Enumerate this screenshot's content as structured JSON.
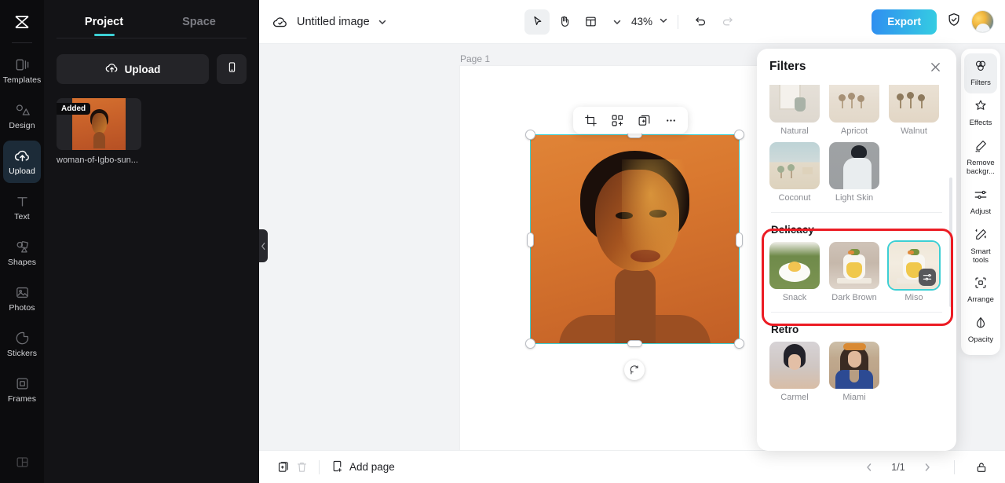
{
  "app": {
    "brand_icon": "capcut-logo-icon",
    "accent_teal": "#3ccfd4",
    "accent_red": "#ec1c24",
    "export_gradient_from": "#2f8ef0",
    "export_gradient_to": "#35cde2"
  },
  "rail": {
    "items": [
      {
        "label": "Templates",
        "icon": "templates-icon",
        "active": false
      },
      {
        "label": "Design",
        "icon": "design-icon",
        "active": false
      },
      {
        "label": "Upload",
        "icon": "upload-cloud-icon",
        "active": true
      },
      {
        "label": "Text",
        "icon": "text-icon",
        "active": false
      },
      {
        "label": "Shapes",
        "icon": "shapes-icon",
        "active": false
      },
      {
        "label": "Photos",
        "icon": "photos-icon",
        "active": false
      },
      {
        "label": "Stickers",
        "icon": "stickers-icon",
        "active": false
      },
      {
        "label": "Frames",
        "icon": "frames-icon",
        "active": false
      }
    ],
    "bottom_icon": "layout-panel-icon"
  },
  "panel": {
    "tabs": [
      {
        "label": "Project",
        "active": true
      },
      {
        "label": "Space",
        "active": false
      }
    ],
    "upload_label": "Upload",
    "phone_upload_icon": "phone-icon",
    "assets": [
      {
        "badge": "Added",
        "name": "woman-of-Igbo-sun..."
      }
    ]
  },
  "topbar": {
    "cloud_icon": "cloud-saved-icon",
    "title": "Untitled image",
    "title_caret_icon": "chevron-down-icon",
    "tools": [
      {
        "name": "select-tool",
        "icon": "cursor-arrow-icon",
        "active": true
      },
      {
        "name": "hand-tool",
        "icon": "hand-icon",
        "active": false
      },
      {
        "name": "layout-tool",
        "icon": "layout-icon",
        "active": false
      }
    ],
    "layout_caret_icon": "chevron-down-icon",
    "zoom": "43%",
    "zoom_caret_icon": "chevron-down-icon",
    "undo_icon": "undo-icon",
    "redo_icon": "redo-icon",
    "export_label": "Export",
    "shield_icon": "shield-check-icon",
    "avatar": "user-avatar"
  },
  "canvas": {
    "page_label": "Page 1",
    "float_toolbar": [
      {
        "name": "crop-button",
        "icon": "crop-icon"
      },
      {
        "name": "smart-cutout-button",
        "icon": "cutout-icon"
      },
      {
        "name": "duplicate-button",
        "icon": "duplicate-icon"
      },
      {
        "name": "more-options-button",
        "icon": "ellipsis-icon"
      }
    ],
    "rotate_icon": "rotate-icon",
    "selected_image_alt": "woman in orange light portrait"
  },
  "bottombar": {
    "duplicate_page_icon": "duplicate-page-icon",
    "delete_page_icon": "trash-icon",
    "add_page_icon": "add-page-icon",
    "add_page_label": "Add page",
    "prev_icon": "chevron-left-icon",
    "page_indicator": "1/1",
    "next_icon": "chevron-right-icon",
    "lock_icon": "unlock-icon"
  },
  "filters_panel": {
    "title": "Filters",
    "close_icon": "close-icon",
    "groups": [
      {
        "title": "",
        "rows": [
          [
            {
              "label": "Natural",
              "thumb": "t-natural",
              "selected": false
            },
            {
              "label": "Apricot",
              "thumb": "t-desert",
              "selected": false
            },
            {
              "label": "Walnut",
              "thumb": "t-walnut-desert",
              "selected": false
            }
          ],
          [
            {
              "label": "Coconut",
              "thumb": "t-coconut",
              "selected": false
            },
            {
              "label": "Light Skin",
              "thumb": "t-light-skin",
              "selected": false
            }
          ]
        ]
      },
      {
        "title": "Delicacy",
        "highlighted": true,
        "rows": [
          [
            {
              "label": "Snack",
              "thumb": "t-snack",
              "selected": false
            },
            {
              "label": "Dark Brown",
              "thumb": "t-cake-dark",
              "selected": false
            },
            {
              "label": "Miso",
              "thumb": "t-cake-light",
              "selected": true,
              "badge_icon": "adjust-sliders-icon"
            }
          ]
        ]
      },
      {
        "title": "Retro",
        "rows": [
          [
            {
              "label": "Carmel",
              "thumb": "t-carmel",
              "selected": false
            },
            {
              "label": "Miami",
              "thumb": "t-miami",
              "selected": false
            }
          ]
        ]
      }
    ]
  },
  "right_rail": {
    "items": [
      {
        "label": "Filters",
        "icon": "filters-icon",
        "active": true
      },
      {
        "label": "Effects",
        "icon": "effects-icon",
        "active": false
      },
      {
        "label": "Remove backgr...",
        "icon": "remove-background-icon",
        "active": false
      },
      {
        "label": "Adjust",
        "icon": "adjust-icon",
        "active": false
      },
      {
        "label": "Smart tools",
        "icon": "smart-tools-icon",
        "active": false
      },
      {
        "label": "Arrange",
        "icon": "arrange-icon",
        "active": false
      },
      {
        "label": "Opacity",
        "icon": "opacity-icon",
        "active": false
      }
    ]
  }
}
